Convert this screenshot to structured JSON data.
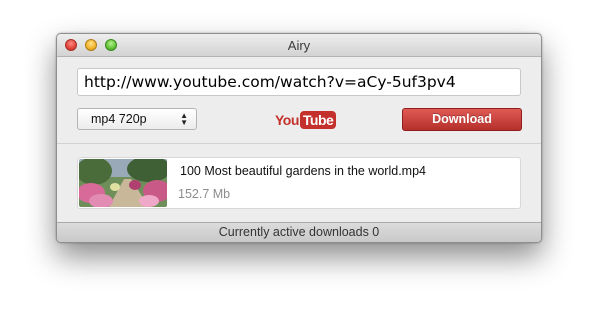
{
  "window": {
    "title": "Airy"
  },
  "url_input": {
    "value": "http://www.youtube.com/watch?v=aCy-5uf3pv4"
  },
  "format_select": {
    "selected": "mp4 720p"
  },
  "youtube_logo": {
    "you": "You",
    "tube": "Tube",
    "brand_color": "#c4302b"
  },
  "download_button": {
    "label": "Download",
    "color": "#c0392b"
  },
  "downloads": [
    {
      "file_name": "100 Most beautiful gardens in the world.mp4",
      "size": "152.7 Mb"
    }
  ],
  "status": {
    "text": "Currently active downloads 0"
  }
}
